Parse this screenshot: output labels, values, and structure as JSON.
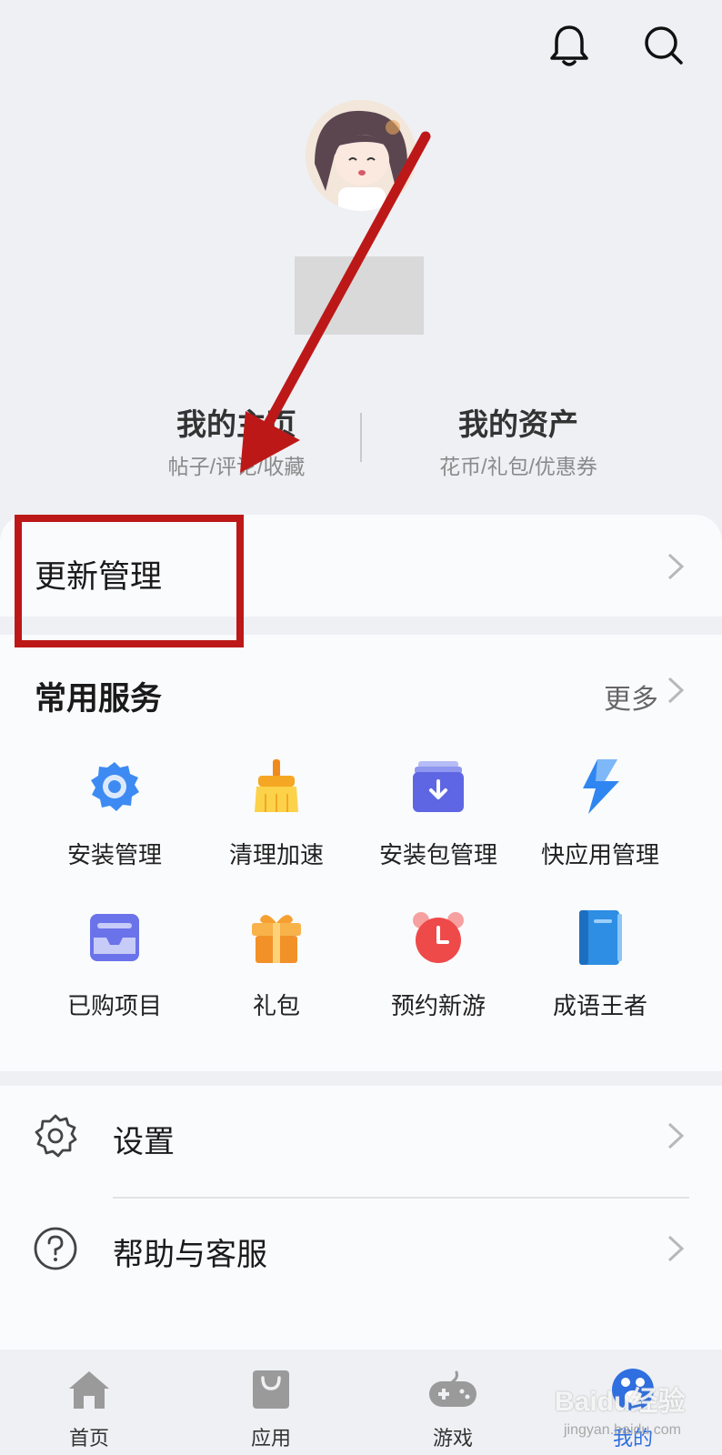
{
  "header": {
    "icons": [
      "bell-icon",
      "search-icon"
    ]
  },
  "profile": {
    "stats": [
      {
        "title": "我的主页",
        "subtitle": "帖子/评论/收藏"
      },
      {
        "title": "我的资产",
        "subtitle": "花币/礼包/优惠券"
      }
    ]
  },
  "update_card": {
    "label": "更新管理"
  },
  "services": {
    "title": "常用服务",
    "more_label": "更多",
    "items": [
      {
        "label": "安装管理",
        "icon": "gear-icon",
        "color": "#3b82f6"
      },
      {
        "label": "清理加速",
        "icon": "broom-icon",
        "color": "#f5b82e"
      },
      {
        "label": "安装包管理",
        "icon": "package-download-icon",
        "color": "#6366f1"
      },
      {
        "label": "快应用管理",
        "icon": "lightning-icon",
        "color": "#3b82f6"
      },
      {
        "label": "已购项目",
        "icon": "purchased-icon",
        "color": "#6470e8"
      },
      {
        "label": "礼包",
        "icon": "gift-icon",
        "color": "#f5a030"
      },
      {
        "label": "预约新游",
        "icon": "alarm-clock-icon",
        "color": "#ef4f4f"
      },
      {
        "label": "成语王者",
        "icon": "book-icon",
        "color": "#2f8fe0"
      }
    ]
  },
  "settings": {
    "items": [
      {
        "label": "设置",
        "icon": "settings-icon"
      },
      {
        "label": "帮助与客服",
        "icon": "help-icon"
      }
    ]
  },
  "bottom_nav": {
    "items": [
      {
        "label": "首页",
        "icon": "home-icon",
        "active": false
      },
      {
        "label": "应用",
        "icon": "shopping-bag-icon",
        "active": false
      },
      {
        "label": "游戏",
        "icon": "gamepad-icon",
        "active": false
      },
      {
        "label": "我的",
        "icon": "paw-icon",
        "active": true
      }
    ]
  },
  "watermark": {
    "brand": "Baidu经验",
    "url": "jingyan.baidu.com"
  },
  "colors": {
    "accent": "#2f6fe0",
    "annotation": "#bd1818"
  }
}
